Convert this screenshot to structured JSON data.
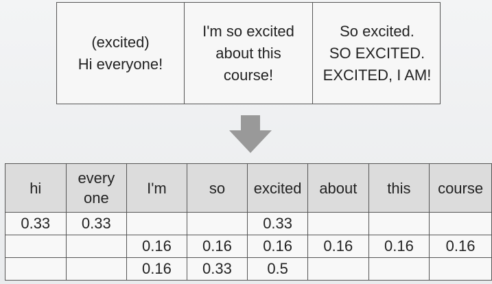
{
  "documents": [
    {
      "lines": [
        "(excited)",
        "Hi everyone!"
      ]
    },
    {
      "lines": [
        "I'm so excited",
        "about this",
        "course!"
      ]
    },
    {
      "lines": [
        "So excited.",
        "SO EXCITED.",
        "EXCITED, I AM!"
      ]
    }
  ],
  "arrow": {
    "icon": "down-arrow-icon",
    "color": "#999999"
  },
  "tf_table": {
    "headers": [
      [
        "hi"
      ],
      [
        "every",
        "one"
      ],
      [
        "I'm"
      ],
      [
        "so"
      ],
      [
        "excited"
      ],
      [
        "about"
      ],
      [
        "this"
      ],
      [
        "course"
      ]
    ],
    "rows": [
      [
        "0.33",
        "0.33",
        "",
        "",
        "0.33",
        "",
        "",
        ""
      ],
      [
        "",
        "",
        "0.16",
        "0.16",
        "0.16",
        "0.16",
        "0.16",
        "0.16"
      ],
      [
        "",
        "",
        "0.16",
        "0.33",
        "0.5",
        "",
        "",
        ""
      ]
    ]
  }
}
